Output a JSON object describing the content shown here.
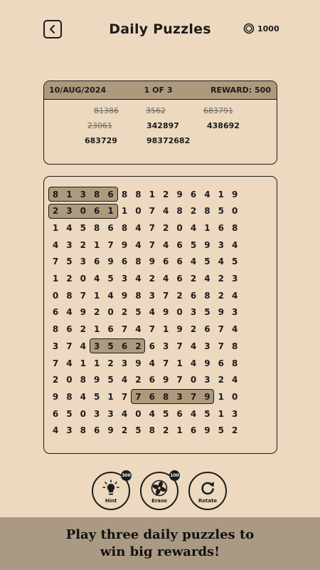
{
  "header": {
    "back_icon": "chevron-left-icon",
    "title": "Daily Puzzles",
    "coin_icon": "coin-icon",
    "coins": "1000"
  },
  "puzzle_info": {
    "date": "10/AUG/2024",
    "progress": "1 OF 3",
    "reward": "REWARD: 500"
  },
  "words": [
    {
      "text": "81386",
      "found": true
    },
    {
      "text": "3562",
      "found": true
    },
    {
      "text": "683791",
      "found": true
    },
    {
      "text": "23061",
      "found": true
    },
    {
      "text": "342897",
      "found": false
    },
    {
      "text": "438692",
      "found": false
    },
    {
      "text": "683729",
      "found": false
    },
    {
      "text": "98372682",
      "found": false
    }
  ],
  "grid": [
    "81386881296419",
    "23061107482850",
    "14586847204168",
    "43217947465934",
    "75369689664545",
    "12045342462423",
    "08714983726824",
    "64920254903593",
    "86216747192674",
    "37435626374378",
    "74112394714968",
    "20895426970324",
    "98451776837910",
    "65033404564513",
    "43869258216952"
  ],
  "found_highlights": [
    {
      "word": "81386",
      "row": 0,
      "col_start": 0,
      "col_end": 4
    },
    {
      "word": "23061",
      "row": 1,
      "col_start": 0,
      "col_end": 4
    },
    {
      "word": "3562",
      "row": 9,
      "col_start": 3,
      "col_end": 6
    },
    {
      "word": "683791",
      "row": 12,
      "col_start": 6,
      "col_end": 11
    }
  ],
  "tools": [
    {
      "id": "hint",
      "label": "Hint",
      "cost": "300",
      "icon": "lightbulb-icon"
    },
    {
      "id": "erase",
      "label": "Erase",
      "cost": "100",
      "icon": "fan-icon"
    },
    {
      "id": "rotate",
      "label": "Rotate",
      "cost": "",
      "icon": "rotate-icon"
    }
  ],
  "footer": {
    "message": "Play three daily puzzles to\nwin big rewards!"
  },
  "colors": {
    "background": "#ecd9bf",
    "accent": "#ad9a7e",
    "footer": "#ab9a83",
    "ink": "#1c1c1c"
  }
}
